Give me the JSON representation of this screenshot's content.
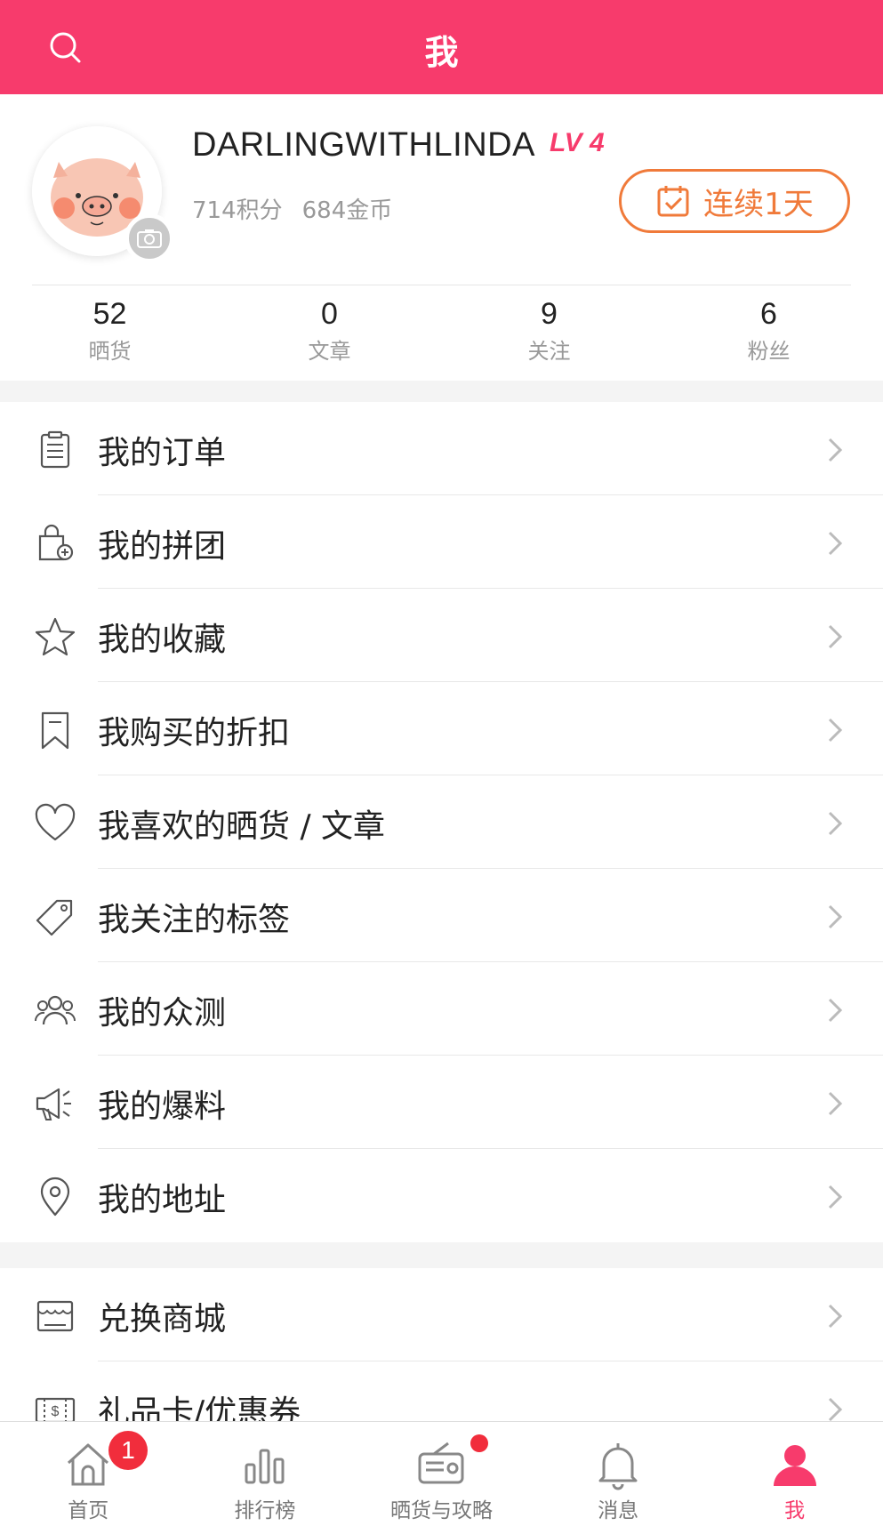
{
  "header": {
    "title": "我"
  },
  "profile": {
    "username": "DARLINGWITHLINDA",
    "level": "LV 4",
    "points": "714积分",
    "coins": "684金币",
    "checkin_label": "连续1天"
  },
  "stats": [
    {
      "value": "52",
      "label": "晒货"
    },
    {
      "value": "0",
      "label": "文章"
    },
    {
      "value": "9",
      "label": "关注"
    },
    {
      "value": "6",
      "label": "粉丝"
    }
  ],
  "menu": {
    "items": [
      {
        "label": "我的订单",
        "icon": "clipboard-icon"
      },
      {
        "label": "我的拼团",
        "icon": "bag-plus-icon"
      },
      {
        "label": "我的收藏",
        "icon": "star-icon"
      },
      {
        "label": "我购买的折扣",
        "icon": "bookmark-icon"
      },
      {
        "label": "我喜欢的晒货 / 文章",
        "icon": "heart-icon"
      },
      {
        "label": "我关注的标签",
        "icon": "tag-icon"
      },
      {
        "label": "我的众测",
        "icon": "people-icon"
      },
      {
        "label": "我的爆料",
        "icon": "megaphone-icon"
      },
      {
        "label": "我的地址",
        "icon": "location-pin-icon"
      }
    ],
    "items2": [
      {
        "label": "兑换商城",
        "icon": "store-icon"
      },
      {
        "label": "礼品卡/优惠券",
        "icon": "gift-card-icon"
      }
    ]
  },
  "tabbar": {
    "tabs": [
      {
        "label": "首页",
        "icon": "home-icon",
        "badge": "1"
      },
      {
        "label": "排行榜",
        "icon": "bar-chart-icon"
      },
      {
        "label": "晒货与攻略",
        "icon": "radio-icon"
      },
      {
        "label": "消息",
        "icon": "bell-icon"
      },
      {
        "label": "我",
        "icon": "user-icon"
      }
    ]
  },
  "colors": {
    "brand": "#f73b6c",
    "checkin": "#f07a3a",
    "badge": "#f12d3c"
  }
}
